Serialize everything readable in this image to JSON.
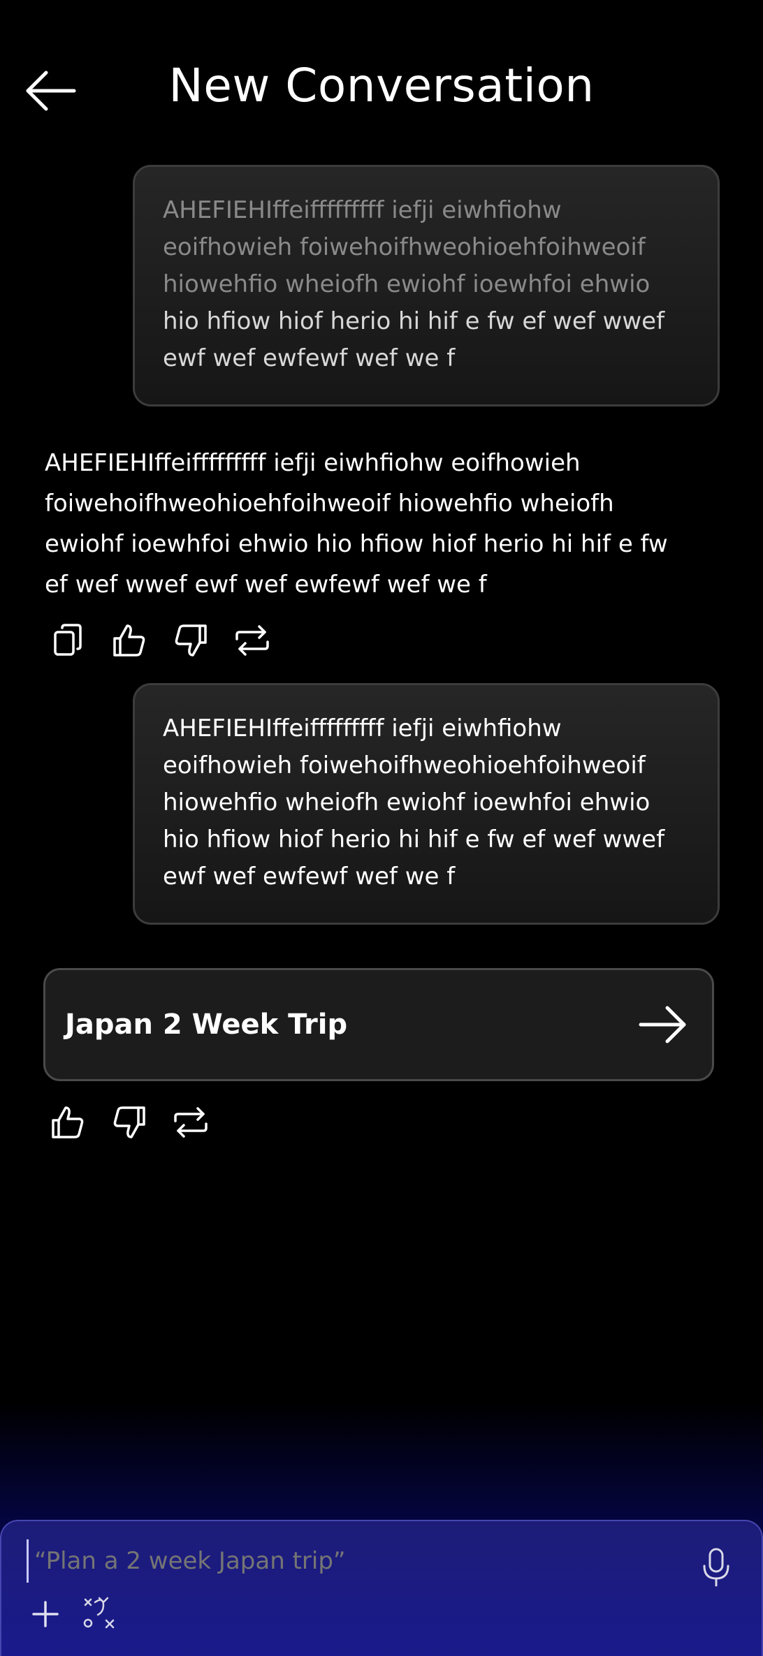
{
  "header": {
    "title": "New Conversation"
  },
  "messages": [
    {
      "role": "user",
      "lines": [
        "AHEFIEHIffeifffffffff iefji eiwhfiohw",
        "eoifhowieh foiwehoifhweohioehfoihweoif",
        "hiowehfio wheiofh ewiohf ioewhfoi ehwio",
        "hio hfiow hiof herio hi hif  e fw ef wef wwef",
        "ewf wef ewfewf wef we f"
      ]
    },
    {
      "role": "assistant",
      "lines": [
        "AHEFIEHIffeifffffffff iefji eiwhfiohw eoifhowieh",
        "foiwehoifhweohioehfoihweoif hiowehfio wheiofh",
        "ewiohf ioewhfoi ehwio hio hfiow hiof herio hi hif  e fw",
        "ef wef wwef ewf wef ewfewf wef we f"
      ]
    },
    {
      "role": "user",
      "lines": [
        "AHEFIEHIffeifffffffff iefji eiwhfiohw",
        "eoifhowieh foiwehoifhweohioehfoihweoif",
        "hiowehfio wheiofh ewiohf ioewhfoi ehwio",
        "hio hfiow hiof herio hi hif  e fw ef wef wwef",
        "ewf wef ewfewf wef we f"
      ]
    }
  ],
  "trip_card": {
    "title": "Japan 2 Week Trip"
  },
  "input": {
    "placeholder": "“Plan a 2 week Japan trip”"
  },
  "icons": {
    "back": "arrow-left-icon",
    "copy": "copy-icon",
    "like": "thumbs-up-icon",
    "dislike": "thumbs-down-icon",
    "regenerate": "repeat-icon",
    "open": "arrow-right-icon",
    "mic": "microphone-icon",
    "add": "plus-icon",
    "tools": "tools-icon"
  },
  "colors": {
    "background": "#000000",
    "bubble": "#1e1e1e",
    "input_bar": "#1a1a8c"
  }
}
